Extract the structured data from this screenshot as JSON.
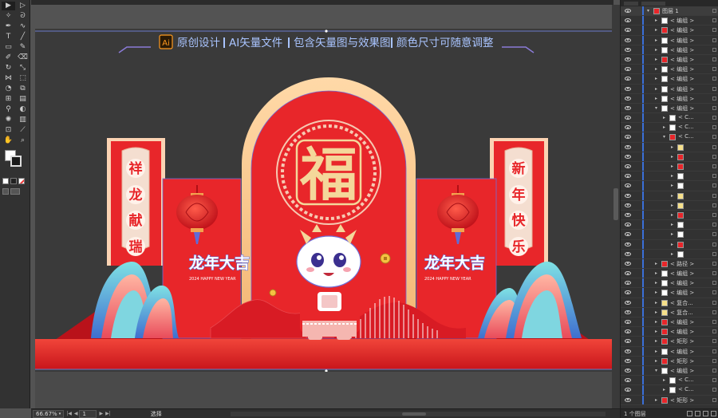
{
  "banner": {
    "ai_badge": "Ai",
    "segments": [
      "原创设计",
      "AI矢量文件",
      "包含矢量图与效果图",
      "颜色尺寸可随意调整"
    ]
  },
  "design": {
    "fu_char": "福",
    "left_couplet": [
      "祥",
      "龙",
      "献",
      "瑞"
    ],
    "right_couplet": [
      "新",
      "年",
      "快",
      "乐"
    ],
    "logo_text": "龙年大吉",
    "logo_sub": "2024 HAPPY NEW YEAR",
    "colors": {
      "red": "#e8262a",
      "gold": "#f4d79a",
      "pink": "#f5c7b3",
      "teal": "#2fb8c6",
      "blue": "#4f6fc7"
    }
  },
  "status": {
    "zoom": "66.67%",
    "page": "1",
    "mode": "选择"
  },
  "layers": {
    "footer": "1 个图层",
    "rows": [
      {
        "label": "图层 1",
        "indent": 0,
        "expanded": true,
        "thumb": "red"
      },
      {
        "label": "< 编组 >",
        "indent": 1,
        "thumb": "white"
      },
      {
        "label": "< 编组 >",
        "indent": 1,
        "thumb": "red"
      },
      {
        "label": "< 编组 >",
        "indent": 1,
        "thumb": "white"
      },
      {
        "label": "< 编组 >",
        "indent": 1,
        "thumb": "white"
      },
      {
        "label": "< 编组 >",
        "indent": 1,
        "thumb": "red"
      },
      {
        "label": "< 编组 >",
        "indent": 1,
        "thumb": "white"
      },
      {
        "label": "< 编组 >",
        "indent": 1,
        "thumb": "white"
      },
      {
        "label": "< 编组 >",
        "indent": 1,
        "thumb": "white"
      },
      {
        "label": "< 编组 >",
        "indent": 1,
        "thumb": "white"
      },
      {
        "label": "< 编组 >",
        "indent": 1,
        "expanded": true,
        "thumb": "white"
      },
      {
        "label": "< C...",
        "indent": 2,
        "thumb": "white"
      },
      {
        "label": "< C...",
        "indent": 2,
        "thumb": "white"
      },
      {
        "label": "< C...",
        "indent": 2,
        "expanded": true,
        "thumb": "red"
      },
      {
        "label": "",
        "indent": 3,
        "thumb": "yellow"
      },
      {
        "label": "",
        "indent": 3,
        "thumb": "red"
      },
      {
        "label": "",
        "indent": 3,
        "thumb": "red"
      },
      {
        "label": "",
        "indent": 3,
        "thumb": "white"
      },
      {
        "label": "",
        "indent": 3,
        "thumb": "white"
      },
      {
        "label": "",
        "indent": 3,
        "thumb": "yellow"
      },
      {
        "label": "",
        "indent": 3,
        "thumb": "yellow"
      },
      {
        "label": "",
        "indent": 3,
        "thumb": "red"
      },
      {
        "label": "",
        "indent": 3,
        "thumb": "white"
      },
      {
        "label": "",
        "indent": 3,
        "thumb": "white"
      },
      {
        "label": "",
        "indent": 3,
        "thumb": "red"
      },
      {
        "label": "",
        "indent": 3,
        "thumb": "white"
      },
      {
        "label": "< 路径 >",
        "indent": 1,
        "thumb": "red"
      },
      {
        "label": "< 编组 >",
        "indent": 1,
        "thumb": "white"
      },
      {
        "label": "< 编组 >",
        "indent": 1,
        "thumb": "white"
      },
      {
        "label": "< 编组 >",
        "indent": 1,
        "thumb": "white"
      },
      {
        "label": "< 复合...",
        "indent": 1,
        "thumb": "yellow"
      },
      {
        "label": "< 复合...",
        "indent": 1,
        "thumb": "yellow"
      },
      {
        "label": "< 编组 >",
        "indent": 1,
        "thumb": "red"
      },
      {
        "label": "< 编组 >",
        "indent": 1,
        "thumb": "red"
      },
      {
        "label": "< 矩形 >",
        "indent": 1,
        "thumb": "red"
      },
      {
        "label": "< 编组 >",
        "indent": 1,
        "thumb": "white"
      },
      {
        "label": "< 矩形 >",
        "indent": 1,
        "thumb": "red"
      },
      {
        "label": "< 编组 >",
        "indent": 1,
        "expanded": true,
        "thumb": "white"
      },
      {
        "label": "< C...",
        "indent": 2,
        "thumb": "white"
      },
      {
        "label": "< C...",
        "indent": 2,
        "thumb": "white"
      },
      {
        "label": "< 矩形 >",
        "indent": 1,
        "thumb": "red"
      }
    ]
  }
}
